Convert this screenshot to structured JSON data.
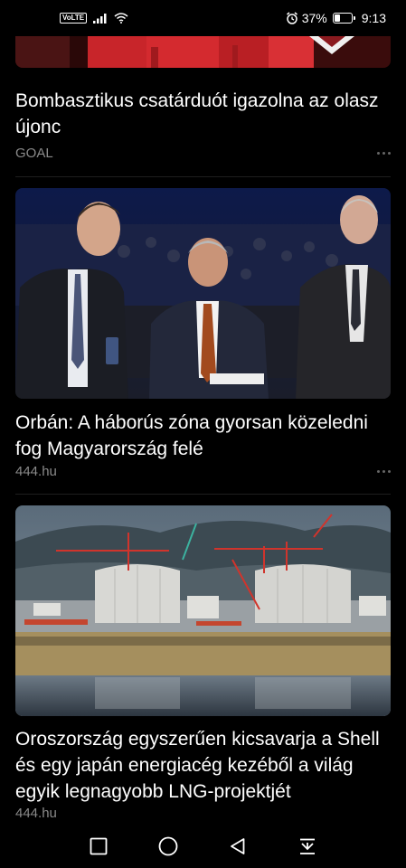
{
  "status_bar": {
    "volte": "VoLTE",
    "battery_percent": "37%",
    "battery_level": 0.37,
    "time": "9:13"
  },
  "feed": [
    {
      "headline": "Bombasztikus csatárduót igazolna az olasz újonc",
      "source": "GOAL",
      "image_desc": "football-players-red-kits"
    },
    {
      "headline": "Orbán: A háborús zóna gyorsan közeledni fog Magyarország felé",
      "source": "444.hu",
      "image_desc": "politicians-in-hall"
    },
    {
      "headline": "Oroszország egyszerűen kicsavarja a Shell és egy japán energiacég kezéből a világ egyik legnagyobb LNG-projektjét",
      "source": "444.hu",
      "image_desc": "lng-plant-tanks"
    }
  ],
  "nav": {
    "recent_icon": "square-icon",
    "home_icon": "circle-icon",
    "back_icon": "triangle-back-icon",
    "notification_icon": "pull-down-icon"
  }
}
